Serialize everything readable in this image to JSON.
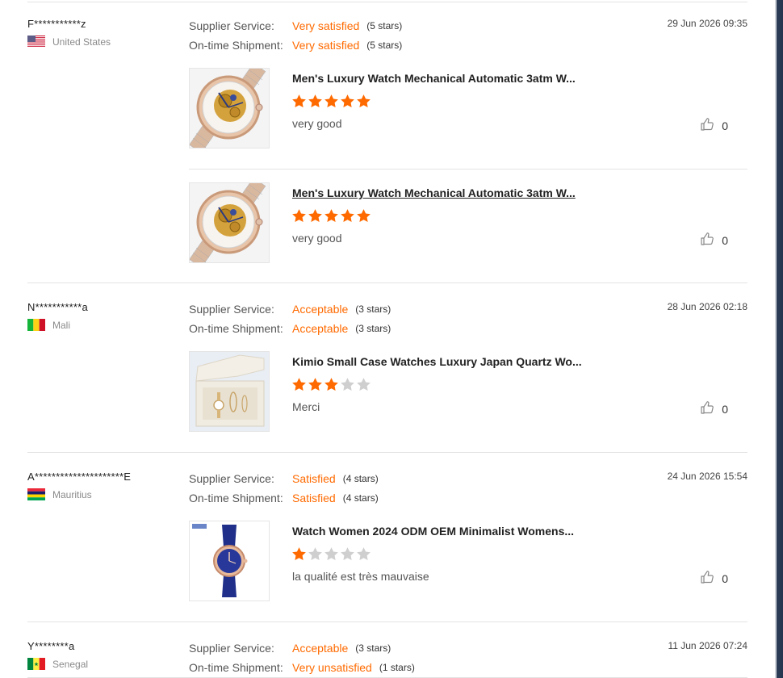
{
  "labels": {
    "supplier_service": "Supplier Service:",
    "on_time_shipment": "On-time Shipment:"
  },
  "colors": {
    "accent": "#ff6a00",
    "star_empty": "#cfcfcf",
    "divider": "#e3e3e3"
  },
  "reviews": [
    {
      "buyer": "F***********z",
      "country": "United States",
      "flag": "us-flag",
      "date": "29 Jun 2026 09:35",
      "supplier_service": {
        "value": "Very satisfied",
        "stars_text": "(5 stars)"
      },
      "on_time_shipment": {
        "value": "Very satisfied",
        "stars_text": "(5 stars)"
      },
      "products": [
        {
          "name": "Men's Luxury Watch Mechanical Automatic 3atm W...",
          "rating": 5,
          "comment": "very good",
          "likes": "0",
          "image": "skeleton-watch-image",
          "hovered": false
        },
        {
          "name": "Men's Luxury Watch Mechanical Automatic 3atm W...",
          "rating": 5,
          "comment": "very good",
          "likes": "0",
          "image": "skeleton-watch-image",
          "hovered": true
        }
      ]
    },
    {
      "buyer": "N***********a",
      "country": "Mali",
      "flag": "mali-flag",
      "date": "28 Jun 2026 02:18",
      "supplier_service": {
        "value": "Acceptable",
        "stars_text": "(3 stars)"
      },
      "on_time_shipment": {
        "value": "Acceptable",
        "stars_text": "(3 stars)"
      },
      "products": [
        {
          "name": "Kimio Small Case Watches Luxury Japan Quartz Wo...",
          "rating": 3,
          "comment": "Merci",
          "likes": "0",
          "image": "watch-gift-box-image",
          "hovered": false
        }
      ]
    },
    {
      "buyer": "A*********************E",
      "country": "Mauritius",
      "flag": "mauritius-flag",
      "date": "24 Jun 2026 15:54",
      "supplier_service": {
        "value": "Satisfied",
        "stars_text": "(4 stars)"
      },
      "on_time_shipment": {
        "value": "Satisfied",
        "stars_text": "(4 stars)"
      },
      "products": [
        {
          "name": "Watch Women 2024 ODM OEM Minimalist Womens...",
          "rating": 1,
          "comment": "la qualité est très mauvaise",
          "likes": "0",
          "image": "blue-strap-watch-image",
          "hovered": false
        }
      ]
    },
    {
      "buyer": "Y********a",
      "country": "Senegal",
      "flag": "senegal-flag",
      "date": "11 Jun 2026 07:24",
      "supplier_service": {
        "value": "Acceptable",
        "stars_text": "(3 stars)"
      },
      "on_time_shipment": {
        "value": "Very unsatisfied",
        "stars_text": "(1 stars)"
      },
      "products": []
    }
  ]
}
